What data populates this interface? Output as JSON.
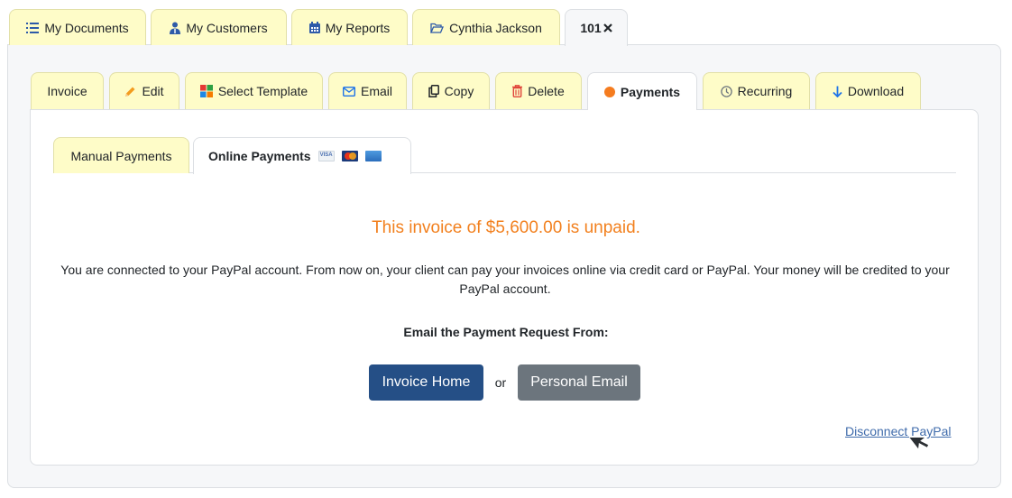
{
  "top_tabs": [
    {
      "label": "My Documents",
      "icon": "list-icon",
      "active": false
    },
    {
      "label": "My Customers",
      "icon": "user-tie-icon",
      "active": false
    },
    {
      "label": "My Reports",
      "icon": "calendar-icon",
      "active": false
    },
    {
      "label": "Cynthia Jackson",
      "icon": "folder-open-icon",
      "active": false
    },
    {
      "label": "101",
      "icon": "close-icon",
      "active": true
    }
  ],
  "action_tabs": [
    {
      "label": "Invoice",
      "icon": null
    },
    {
      "label": "Edit",
      "icon": "pencil-icon"
    },
    {
      "label": "Select Template",
      "icon": "template-grid-icon"
    },
    {
      "label": "Email",
      "icon": "envelope-icon"
    },
    {
      "label": "Copy",
      "icon": "copy-icon"
    },
    {
      "label": "Delete",
      "icon": "trash-icon"
    },
    {
      "label": "Payments",
      "icon": "status-dot-icon",
      "active": true
    },
    {
      "label": "Recurring",
      "icon": "clock-icon"
    },
    {
      "label": "Download",
      "icon": "arrow-down-icon"
    }
  ],
  "payment_tabs": [
    {
      "label": "Manual Payments",
      "active": false
    },
    {
      "label": "Online Payments",
      "active": true,
      "card_icons": [
        "visa-icon",
        "mastercard-icon",
        "amex-icon"
      ]
    }
  ],
  "status": {
    "unpaid_message": "This invoice of $5,600.00 is unpaid.",
    "color": "#f2801e"
  },
  "description": "You are connected to your PayPal account. From now on, your client can pay your invoices online via credit card or PayPal. Your money will be credited to your PayPal account.",
  "email_from_label": "Email the Payment Request From:",
  "buttons": {
    "invoice_home": "Invoice Home",
    "or": "or",
    "personal_email": "Personal Email"
  },
  "disconnect_link": "Disconnect PayPal",
  "colors": {
    "tab_inactive": "#fefcc8",
    "primary_button": "#254f86",
    "secondary_button": "#6c757d",
    "link": "#3f6bab"
  }
}
